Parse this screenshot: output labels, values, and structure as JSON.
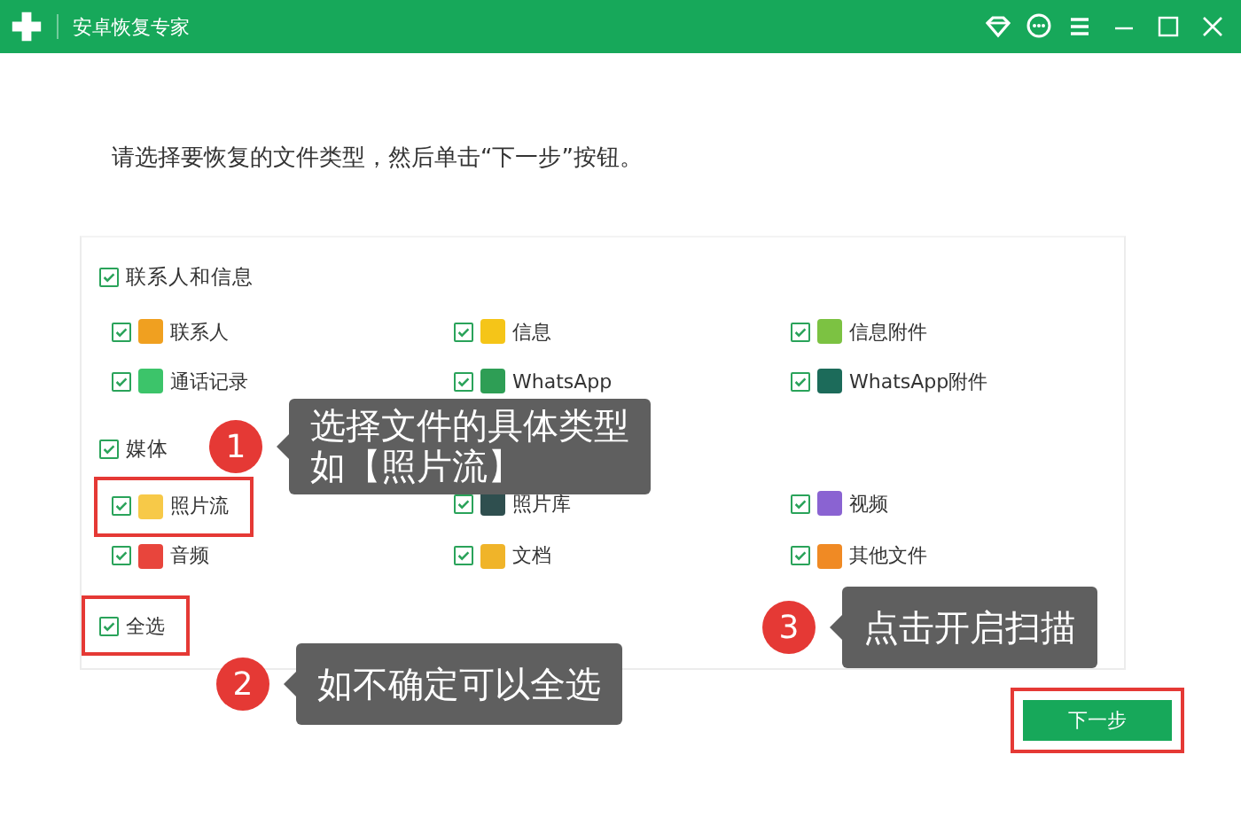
{
  "window": {
    "title": "安卓恢复专家"
  },
  "instruction": "请选择要恢复的文件类型，然后单击“下一步”按钮。",
  "groups": [
    {
      "label": "联系人和信息",
      "checked": true,
      "items": [
        {
          "label": "联系人",
          "checked": true,
          "color": "#f0a020",
          "highlighted": false
        },
        {
          "label": "信息",
          "checked": true,
          "color": "#f5c518",
          "highlighted": false
        },
        {
          "label": "信息附件",
          "checked": true,
          "color": "#7cc242",
          "highlighted": false
        },
        {
          "label": "通话记录",
          "checked": true,
          "color": "#3cc46a",
          "highlighted": false
        },
        {
          "label": "WhatsApp",
          "checked": true,
          "color": "#2e9e55",
          "highlighted": false
        },
        {
          "label": "WhatsApp附件",
          "checked": true,
          "color": "#1c6b5a",
          "highlighted": false
        }
      ]
    },
    {
      "label": "媒体",
      "checked": true,
      "items": [
        {
          "label": "照片流",
          "checked": true,
          "color": "#f7c948",
          "highlighted": true
        },
        {
          "label": "照片库",
          "checked": true,
          "color": "#2f4f4f",
          "highlighted": false
        },
        {
          "label": "视频",
          "checked": true,
          "color": "#8a63d2",
          "highlighted": false
        },
        {
          "label": "音频",
          "checked": true,
          "color": "#e8453c",
          "highlighted": false
        },
        {
          "label": "文档",
          "checked": true,
          "color": "#f0b429",
          "highlighted": false
        },
        {
          "label": "其他文件",
          "checked": true,
          "color": "#f08a24",
          "highlighted": false
        }
      ]
    }
  ],
  "select_all": {
    "label": "全选",
    "checked": true,
    "highlighted": true
  },
  "next_button": {
    "label": "下一步",
    "highlighted": true
  },
  "callouts": [
    {
      "number": "1",
      "lines": [
        "选择文件的具体类型",
        "如【照片流】"
      ]
    },
    {
      "number": "2",
      "lines": [
        "如不确定可以全选"
      ]
    },
    {
      "number": "3",
      "lines": [
        "点击开启扫描"
      ]
    }
  ]
}
